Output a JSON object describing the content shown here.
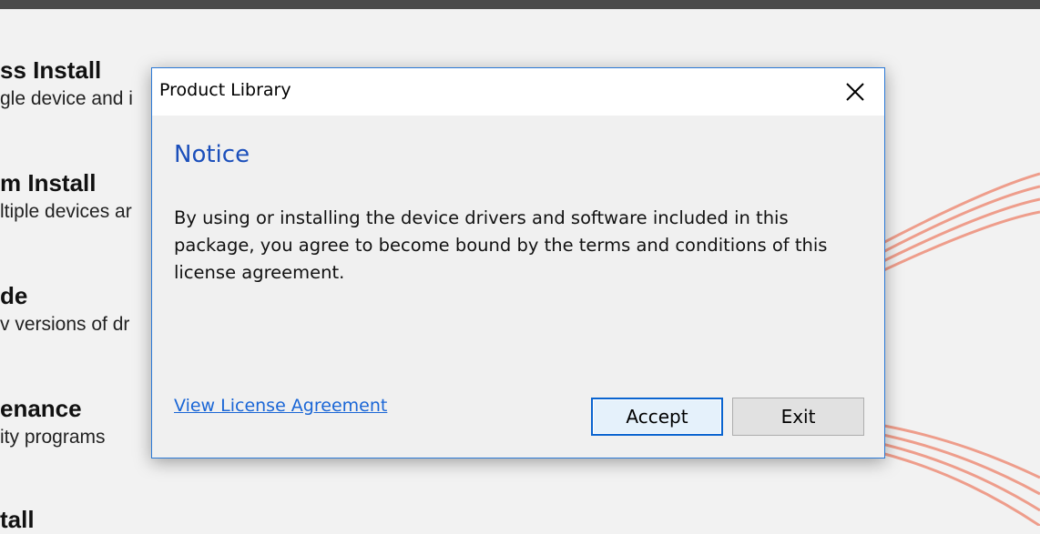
{
  "background": {
    "items": [
      {
        "title": "ss Install",
        "desc": "gle device and i"
      },
      {
        "title": "m Install",
        "desc": "ltiple devices ar"
      },
      {
        "title": "de",
        "desc": "v versions of dr"
      },
      {
        "title": "enance",
        "desc": "ity programs"
      },
      {
        "title": "tall",
        "desc": ""
      }
    ]
  },
  "dialog": {
    "title": "Product Library",
    "heading": "Notice",
    "body": "By using or installing the device drivers and software included in this package, you agree to become bound by the terms and conditions of this license agreement.",
    "link": "View License Agreement",
    "accept_label": "Accept",
    "exit_label": "Exit"
  },
  "icons": {
    "close": "close-icon"
  },
  "colors": {
    "accent": "#2b79d6",
    "heading": "#1b4fbb",
    "link": "#1a66d6",
    "swoosh": "#e8735c"
  }
}
